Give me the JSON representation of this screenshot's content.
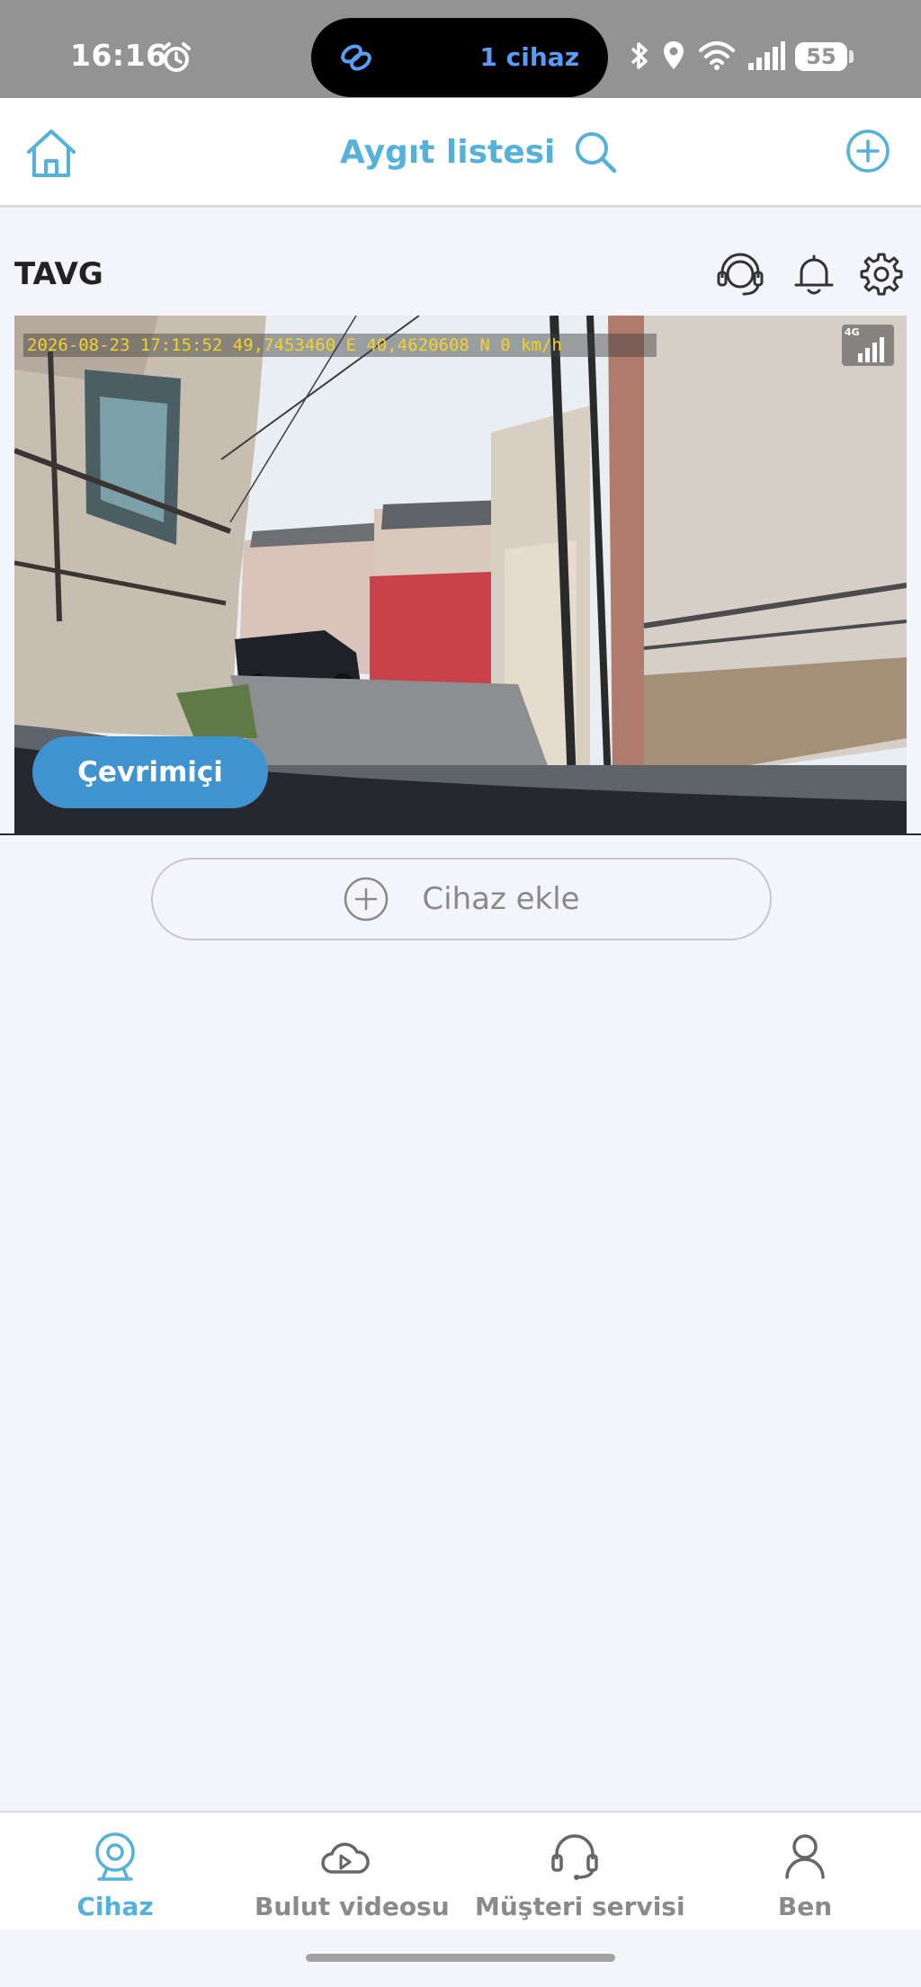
{
  "status_bar": {
    "time": "16:16",
    "island_text": "1 cihaz",
    "battery": "55",
    "island_color": "#5b9df5"
  },
  "header": {
    "title": "Aygıt listesi",
    "icons": [
      "home-icon",
      "search-icon",
      "add-circle-icon"
    ],
    "accent_color": "#54b2da"
  },
  "device": {
    "name": "TAVG",
    "icons": [
      "support-headset-icon",
      "bell-icon",
      "gear-icon"
    ],
    "osd_text": "2026-08-23 17:15:52  49,7453460 E 40,4620608 N 0 km/h",
    "network": "4G",
    "status": "Çevrimiçi",
    "status_color": "#3f94cf"
  },
  "add_device": {
    "label": "Cihaz ekle"
  },
  "bottom_nav": {
    "items": [
      {
        "label": "Cihaz",
        "icon": "camera-icon",
        "active": true
      },
      {
        "label": "Bulut videosu",
        "icon": "cloud-play-icon",
        "active": false
      },
      {
        "label": "Müşteri servisi",
        "icon": "headset-icon",
        "active": false
      },
      {
        "label": "Ben",
        "icon": "user-icon",
        "active": false
      }
    ]
  }
}
